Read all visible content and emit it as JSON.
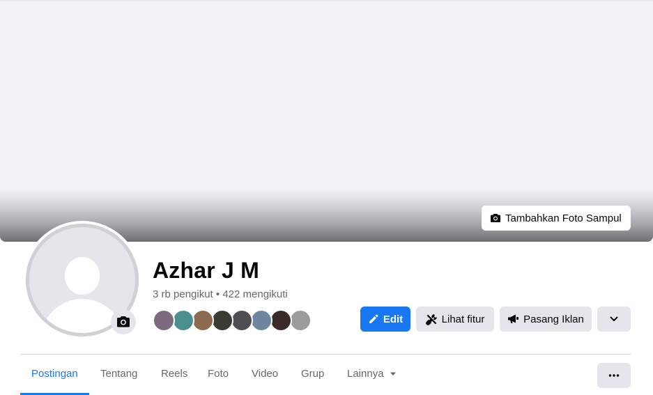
{
  "profile": {
    "name": "Azhar J M",
    "followers": "3 rb pengikut",
    "separator": " • ",
    "following": "422 mengikuti"
  },
  "cover": {
    "add_cover_label": "Tambahkan Foto Sampul",
    "icon": "camera-icon"
  },
  "actions": {
    "edit_label": "Edit",
    "features_label": "Lihat fitur",
    "ads_label": "Pasang Iklan",
    "expand_icon": "chevron-down-icon"
  },
  "friend_avatars": [
    {
      "color": "#7d6a7f"
    },
    {
      "color": "#4a8f8c"
    },
    {
      "color": "#8b6a4f"
    },
    {
      "color": "#3b3b36"
    },
    {
      "color": "#4e4e52"
    },
    {
      "color": "#6f86a0"
    },
    {
      "color": "#3a2a28"
    },
    {
      "color": "#9b9b9b"
    }
  ],
  "tabs": [
    {
      "label": "Postingan",
      "active": true
    },
    {
      "label": "Tentang"
    },
    {
      "label": "Reels"
    },
    {
      "label": "Foto"
    },
    {
      "label": "Video"
    },
    {
      "label": "Grup"
    },
    {
      "label": "Lainnya"
    }
  ],
  "colors": {
    "accent": "#1877f2",
    "secondary_button": "#e4e6eb",
    "muted_text": "#65676b"
  }
}
